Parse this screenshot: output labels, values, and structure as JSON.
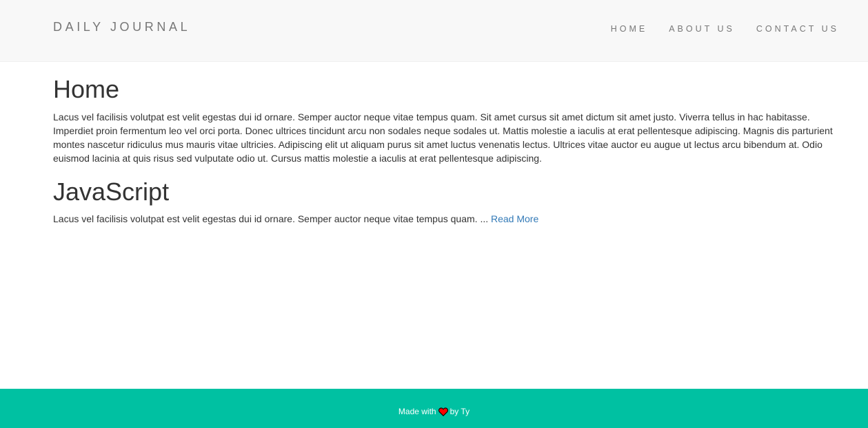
{
  "navbar": {
    "brand": "DAILY JOURNAL",
    "links": [
      {
        "label": "HOME"
      },
      {
        "label": "ABOUT US"
      },
      {
        "label": "CONTACT US"
      }
    ]
  },
  "main": {
    "home": {
      "title": "Home",
      "body": "Lacus vel facilisis volutpat est velit egestas dui id ornare. Semper auctor neque vitae tempus quam. Sit amet cursus sit amet dictum sit amet justo. Viverra tellus in hac habitasse. Imperdiet proin fermentum leo vel orci porta. Donec ultrices tincidunt arcu non sodales neque sodales ut. Mattis molestie a iaculis at erat pellentesque adipiscing. Magnis dis parturient montes nascetur ridiculus mus mauris vitae ultricies. Adipiscing elit ut aliquam purus sit amet luctus venenatis lectus. Ultrices vitae auctor eu augue ut lectus arcu bibendum at. Odio euismod lacinia at quis risus sed vulputate odio ut. Cursus mattis molestie a iaculis at erat pellentesque adipiscing."
    },
    "posts": [
      {
        "title": "JavaScript",
        "excerpt": "Lacus vel facilisis volutpat est velit egestas dui id ornare. Semper auctor neque vitae tempus quam. ...",
        "read_more": "Read More"
      }
    ]
  },
  "footer": {
    "made_with": "Made with",
    "heart_icon": "heart-icon",
    "by": "by Ty"
  },
  "colors": {
    "navbar_bg": "#f8f8f8",
    "footer_bg": "#00c1a2",
    "link": "#337ab7",
    "heart": "#ff0000"
  }
}
